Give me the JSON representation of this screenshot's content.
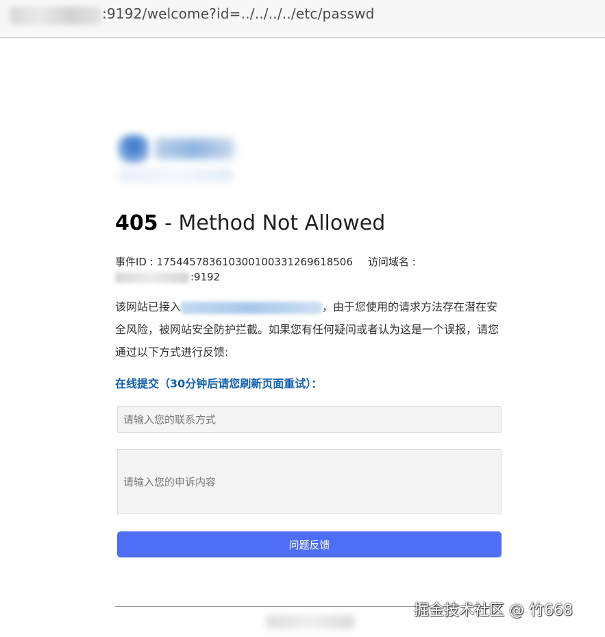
{
  "browser": {
    "url_visible": ":9192/welcome?id=../../../../etc/passwd"
  },
  "error": {
    "code": "405",
    "message": " - Method Not Allowed"
  },
  "meta": {
    "event_id_label": "事件ID : ",
    "event_id": "175445783610300100331269618506",
    "domain_label": "访问域名 :",
    "domain_suffix": ":9192"
  },
  "description": {
    "part1": "该网站已接入",
    "part2": "，由于您使用的请求方法存在潜在安全风险，被网站安全防护拦截。如果您有任何疑问或者认为这是一个误报，请您通过以下方式进行反馈:"
  },
  "form": {
    "title": "在线提交（30分钟后请您刷新页面重试）：",
    "contact_placeholder": "请输入您的联系方式",
    "appeal_placeholder": "请输入您的申诉内容",
    "submit_label": "问题反馈"
  },
  "watermark": "掘金技术社区 @ 竹668",
  "colors": {
    "accent_button": "#4f6ef7",
    "submit_title": "#0f5fb0"
  }
}
